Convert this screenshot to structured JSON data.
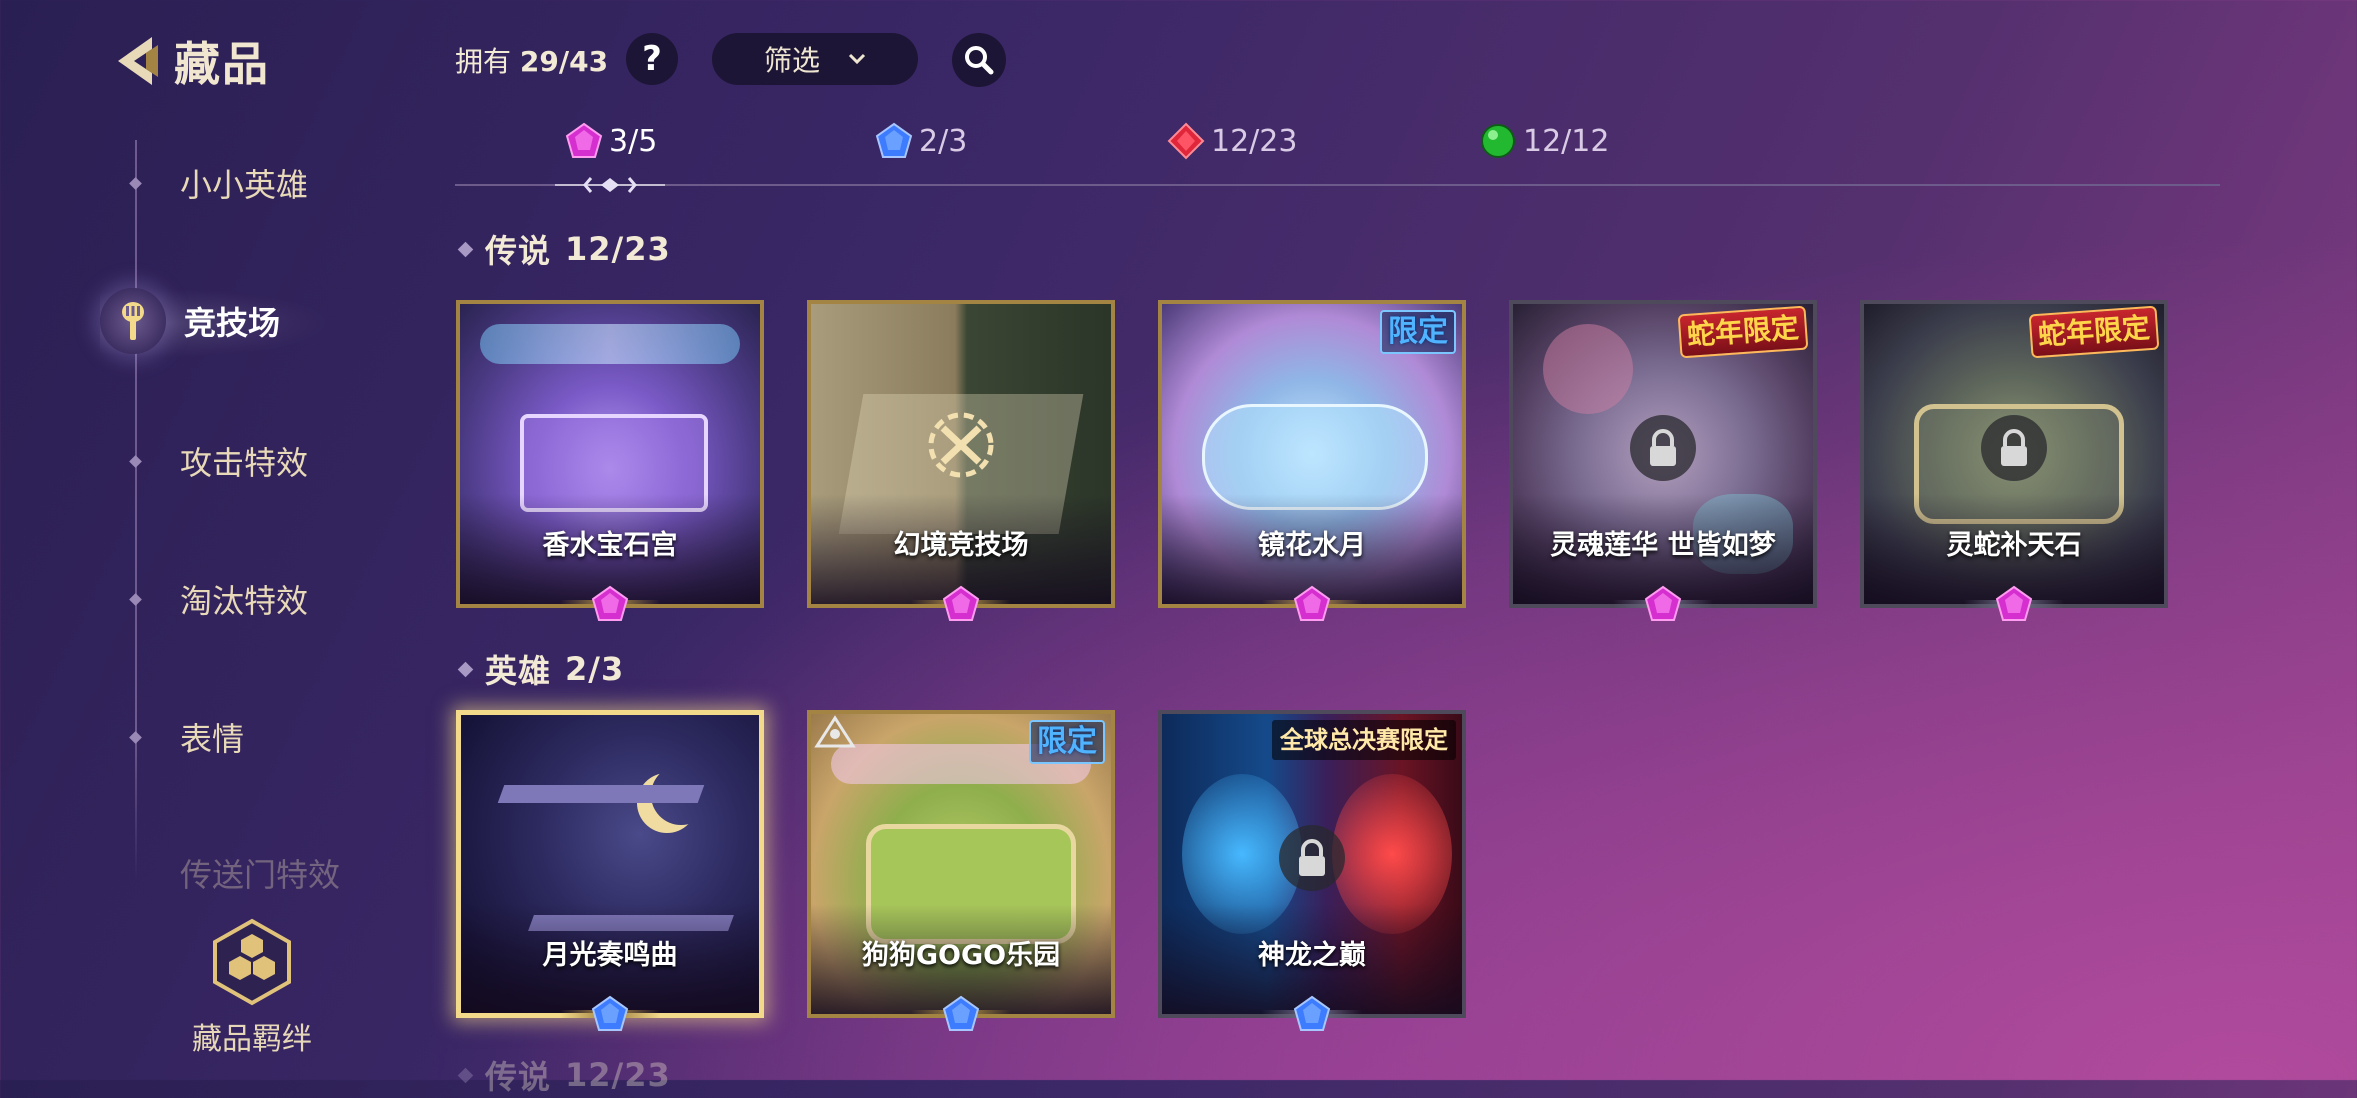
{
  "header": {
    "back_title": "藏品"
  },
  "sidebar": {
    "items": [
      {
        "label": "小小英雄"
      },
      {
        "label": "竞技场"
      },
      {
        "label": "攻击特效"
      },
      {
        "label": "淘汰特效"
      },
      {
        "label": "表情"
      },
      {
        "label": "传送门特效"
      }
    ],
    "active_index": 1,
    "bond_label": "藏品羁绊"
  },
  "topbar": {
    "owned_prefix": "拥有",
    "owned_count": "29/43",
    "help_label": "?",
    "filter_label": "筛选"
  },
  "rarity_tabs": [
    {
      "count": "3/5",
      "gem": "purple-gem-icon"
    },
    {
      "count": "2/3",
      "gem": "blue-gem-icon"
    },
    {
      "count": "12/23",
      "gem": "red-gem-icon"
    },
    {
      "count": "12/12",
      "gem": "green-orb-icon"
    }
  ],
  "sections": [
    {
      "title": "传说",
      "count": "12/23",
      "cards": [
        {
          "name": "香水宝石宫",
          "status": "owned",
          "gem": "purple-gem-icon"
        },
        {
          "name": "幻境竞技场",
          "status": "owned",
          "gem": "purple-gem-icon"
        },
        {
          "name": "镜花水月",
          "status": "owned",
          "tag": "限定",
          "gem": "purple-gem-icon"
        },
        {
          "name": "灵魂莲华 世皆如梦",
          "status": "locked",
          "tag": "蛇年限定",
          "gem": "purple-gem-icon"
        },
        {
          "name": "灵蛇补天石",
          "status": "locked",
          "tag": "蛇年限定",
          "gem": "purple-gem-icon"
        }
      ]
    },
    {
      "title": "英雄",
      "count": "2/3",
      "cards": [
        {
          "name": "月光奏鸣曲",
          "status": "selected",
          "gem": "blue-gem-icon"
        },
        {
          "name": "狗狗GOGO乐园",
          "status": "owned",
          "tag": "限定",
          "gem": "blue-gem-icon"
        },
        {
          "name": "神龙之巅",
          "status": "locked",
          "tag": "全球总决赛限定",
          "gem": "blue-gem-icon"
        }
      ]
    },
    {
      "title": "传说",
      "count": "12/23"
    }
  ],
  "colors": {
    "purple_gem": "#d62fd0",
    "blue_gem": "#3d7bff",
    "red_gem": "#e0263a",
    "green_orb": "#22b830",
    "gold_frame": "#a38443"
  }
}
